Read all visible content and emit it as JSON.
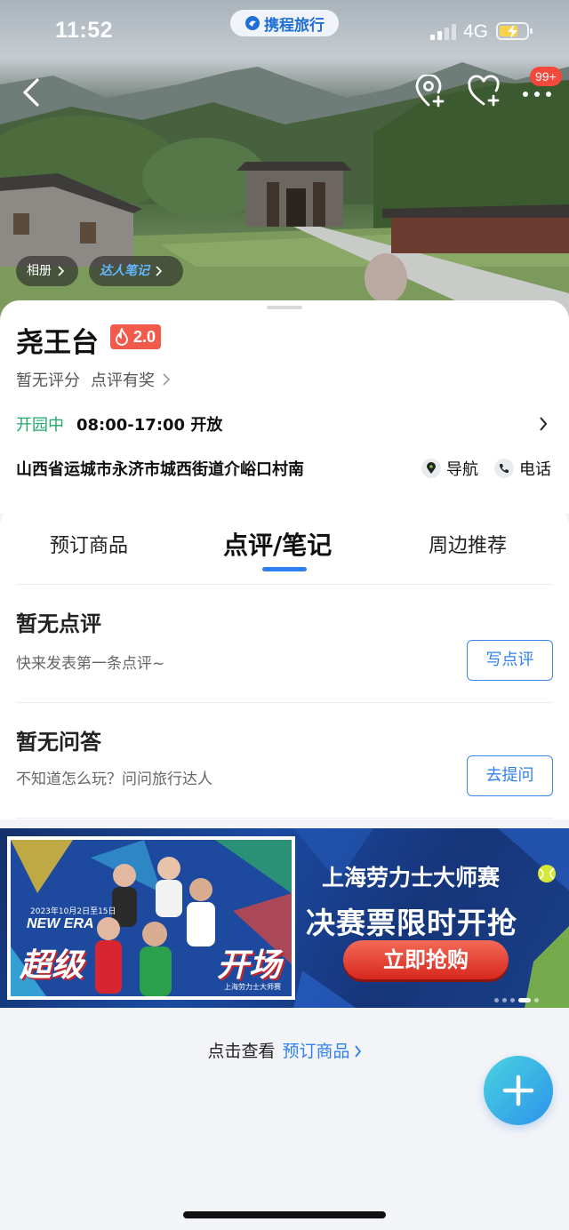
{
  "status_bar": {
    "time": "11:52",
    "brand": "携程旅行",
    "network": "4G"
  },
  "hero": {
    "nav_badge": "99+",
    "album_label": "相册",
    "notes_label": "达人笔记"
  },
  "attraction": {
    "name": "尧王台",
    "heat_score": "2.0",
    "rating_text": "暂无评分",
    "review_reward": "点评有奖",
    "open_status": "开园中",
    "hours": "08:00-17:00 开放",
    "address": "山西省运城市永济市城西街道介峪口村南",
    "nav_label": "导航",
    "call_label": "电话"
  },
  "tabs": [
    {
      "label": "预订商品"
    },
    {
      "label": "点评/笔记"
    },
    {
      "label": "周边推荐"
    }
  ],
  "reviews": {
    "title": "暂无点评",
    "subtitle": "快来发表第一条点评~",
    "button": "写点评"
  },
  "qa": {
    "title": "暂无问答",
    "subtitle": "不知道怎么玩？问问旅行达人",
    "button": "去提问"
  },
  "banner": {
    "era_text": "NEW ERA",
    "date_text": "2023年10月2日至15日",
    "big_left": "超级",
    "big_right": "开场",
    "small_brand": "上海劳力士大师赛",
    "headline": "上海劳力士大师赛",
    "tagline": "决赛票限时开抢",
    "cta": "立即抢购"
  },
  "footer": {
    "prefix": "点击查看",
    "target": "预订商品"
  },
  "colors": {
    "accent": "#2f7ff0",
    "open_green": "#1fa96a",
    "heat_red": "#f25a4c"
  }
}
